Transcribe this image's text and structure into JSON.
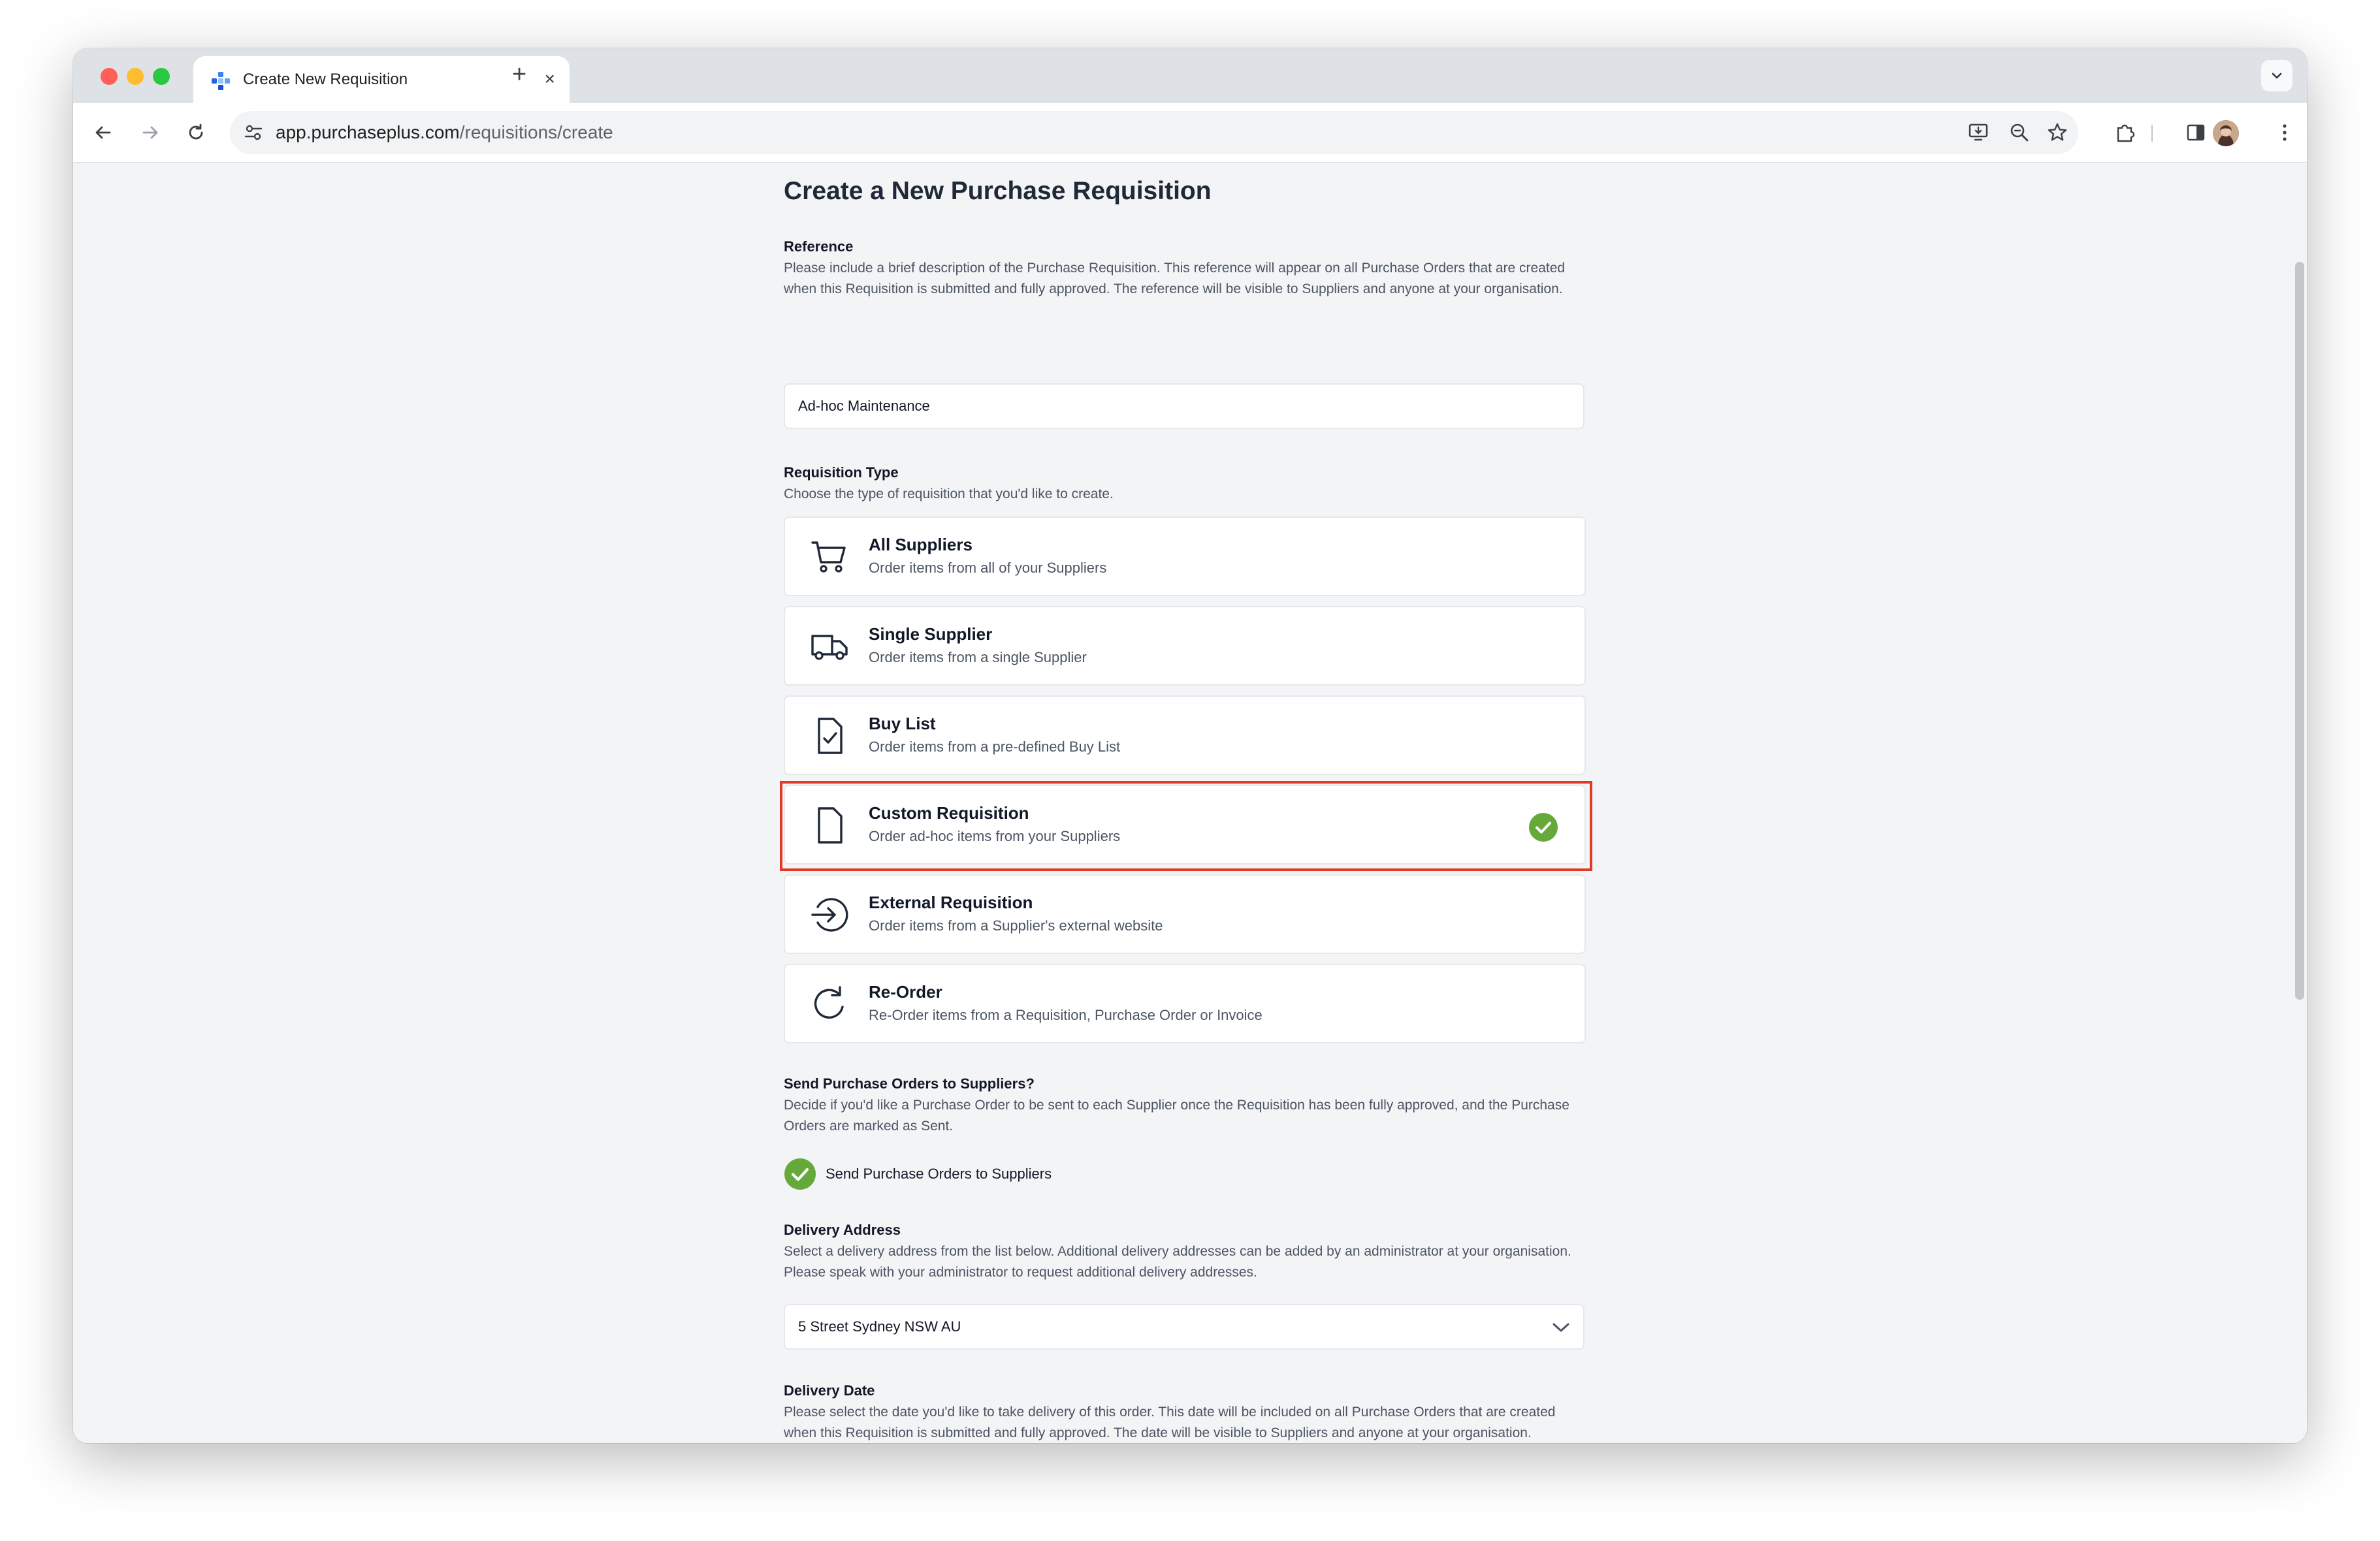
{
  "browser": {
    "tab_title": "Create New Requisition",
    "new_tab_symbol": "+",
    "close_symbol": "×",
    "url_host": "app.purchaseplus.com",
    "url_path": "/requisitions/create"
  },
  "page": {
    "title": "Create a New Purchase Requisition"
  },
  "reference": {
    "label": "Reference",
    "help": "Please include a brief description of the Purchase Requisition. This reference will appear on all Purchase Orders that are created when this Requisition is submitted and fully approved. The reference will be visible to Suppliers and anyone at your organisation.",
    "value": "Ad-hoc Maintenance"
  },
  "requisition_type": {
    "label": "Requisition Type",
    "help": "Choose the type of requisition that you'd like to create.",
    "selected": "Custom Requisition",
    "options": [
      {
        "title": "All Suppliers",
        "description": "Order items from all of your Suppliers",
        "icon": "cart-icon"
      },
      {
        "title": "Single Supplier",
        "description": "Order items from a single Supplier",
        "icon": "truck-icon"
      },
      {
        "title": "Buy List",
        "description": "Order items from a pre-defined Buy List",
        "icon": "document-check-icon"
      },
      {
        "title": "Custom Requisition",
        "description": "Order ad-hoc items from your Suppliers",
        "icon": "document-icon"
      },
      {
        "title": "External Requisition",
        "description": "Order items from a Supplier's external website",
        "icon": "arrow-circle-right-icon"
      },
      {
        "title": "Re-Order",
        "description": "Re-Order items from a Requisition, Purchase Order or Invoice",
        "icon": "refresh-icon"
      }
    ]
  },
  "send_po": {
    "label": "Send Purchase Orders to Suppliers?",
    "help": "Decide if you'd like a Purchase Order to be sent to each Supplier once the Requisition has been fully approved, and the Purchase Orders are marked as Sent.",
    "toggle_label": "Send Purchase Orders to Suppliers",
    "checked": true
  },
  "delivery_address": {
    "label": "Delivery Address",
    "help": "Select a delivery address from the list below. Additional delivery addresses can be added by an administrator at your organisation. Please speak with your administrator to request additional delivery addresses.",
    "value": "5 Street  Sydney NSW AU"
  },
  "delivery_date": {
    "label": "Delivery Date",
    "help": "Please select the date you'd like to take delivery of this order. This date will be included on all Purchase Orders that are created when this Requisition is submitted and fully approved. The date will be visible to Suppliers and anyone at your organisation."
  },
  "colors": {
    "accent_check": "#65a93a",
    "highlight": "#e03c25"
  }
}
